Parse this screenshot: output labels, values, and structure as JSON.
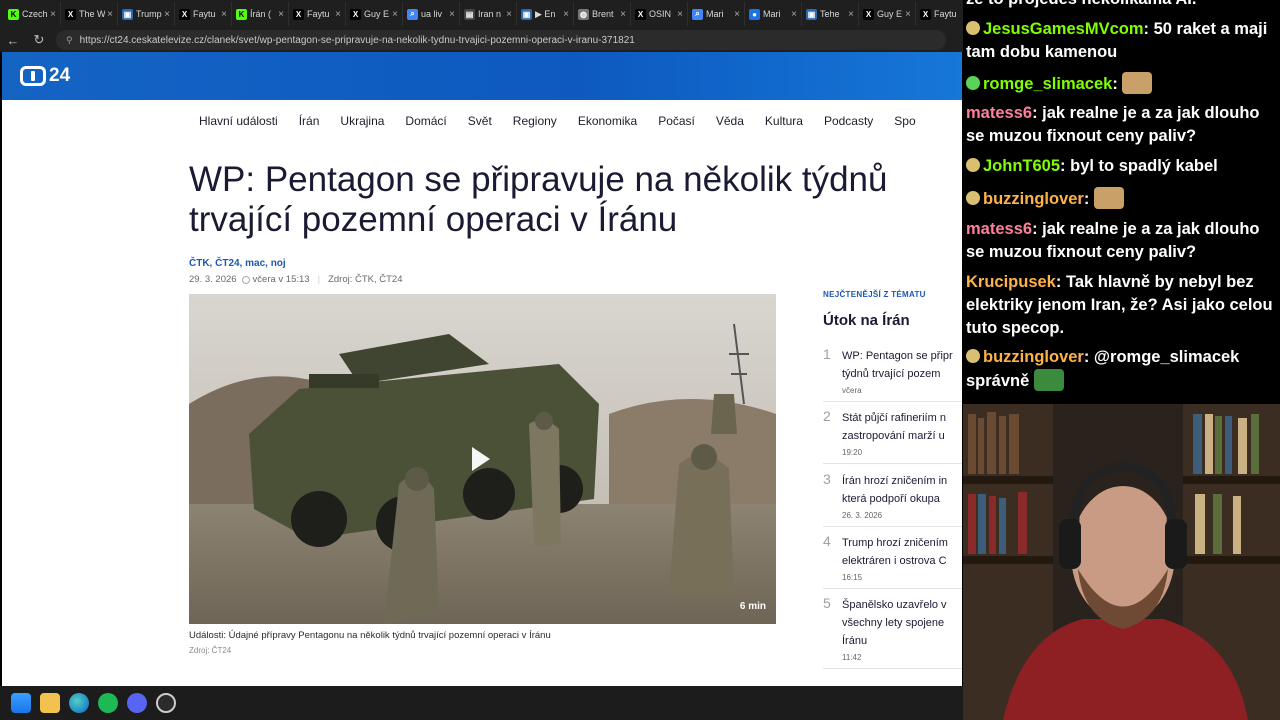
{
  "browser": {
    "tabs": [
      {
        "label": "Czech",
        "icon": "k-logo-icon",
        "color": "#53fc18"
      },
      {
        "label": "The W",
        "icon": "x-logo-icon",
        "color": "#000000"
      },
      {
        "label": "Trump",
        "icon": "tv-icon",
        "color": "#2b6cb0"
      },
      {
        "label": "Faytu",
        "icon": "x-logo-icon",
        "color": "#000000"
      },
      {
        "label": "Írán (",
        "icon": "k-logo-icon",
        "color": "#53fc18"
      },
      {
        "label": "Faytu",
        "icon": "x-logo-icon",
        "color": "#000000"
      },
      {
        "label": "Guy E",
        "icon": "x-logo-icon",
        "color": "#000000"
      },
      {
        "label": "ua liv",
        "icon": "search-icon",
        "color": "#4285f4"
      },
      {
        "label": "Iran n",
        "icon": "news-icon",
        "color": "#ffffff"
      },
      {
        "label": "▶ En",
        "icon": "tv-icon",
        "color": "#2b6cb0"
      },
      {
        "label": "Brent",
        "icon": "globe-icon",
        "color": "#777777"
      },
      {
        "label": "OSIN",
        "icon": "x-logo-icon",
        "color": "#000000"
      },
      {
        "label": "Mari",
        "icon": "search-icon",
        "color": "#4285f4"
      },
      {
        "label": "Mari",
        "icon": "circle-icon",
        "color": "#1a73e8"
      },
      {
        "label": "Tehe",
        "icon": "tv-icon",
        "color": "#2b6cb0"
      },
      {
        "label": "Guy E",
        "icon": "x-logo-icon",
        "color": "#000000"
      },
      {
        "label": "Faytu",
        "icon": "x-logo-icon",
        "color": "#000000"
      }
    ],
    "url": "https://ct24.ceskatelevize.cz/clanek/svet/wp-pentagon-se-pripravuje-na-nekolik-tydnu-trvajici-pozemni-operaci-v-iranu-371821"
  },
  "site": {
    "logo_text": "24",
    "nav": [
      "Hlavní události",
      "Írán",
      "Ukrajina",
      "Domácí",
      "Svět",
      "Regiony",
      "Ekonomika",
      "Počasí",
      "Věda",
      "Kultura",
      "Podcasty",
      "Spo"
    ]
  },
  "article": {
    "headline": "WP: Pentagon se připravuje na několik týdnů trvající pozemní operaci v Íránu",
    "authors": "ČTK, ČT24, mac, noj",
    "date": "29. 3. 2026",
    "updated": "včera v 15:13",
    "source": "Zdroj: ČTK, ČT24",
    "video_duration": "6 min",
    "caption": "Události: Údajné přípravy Pentagonu na několik týdnů trvající pozemní operaci v Íránu",
    "caption_source": "Zdroj: ČT24"
  },
  "sidebar": {
    "kicker": "NEJČTENĚJŠÍ Z TÉMATU",
    "title": "Útok na Írán",
    "items": [
      {
        "num": "1",
        "text": "WP: Pentagon se připr\ntýdnů trvající pozem",
        "time": "včera"
      },
      {
        "num": "2",
        "text": "Stát půjčí rafineriím n\nzastropování marží u",
        "time": "19:20"
      },
      {
        "num": "3",
        "text": "Írán hrozí zničením in\nkterá podpoří okupa",
        "time": "26. 3. 2026"
      },
      {
        "num": "4",
        "text": "Trump hrozí zničením\nelektráren i ostrova C",
        "time": "16:15"
      },
      {
        "num": "5",
        "text": "Španělsko uzavřelo v\nvšechny lety spojene\nÍránu",
        "time": "11:42"
      }
    ]
  },
  "chat": {
    "top_partial": "že to projedes několikama AI.",
    "messages": [
      {
        "user": "JesusGamesMVcom",
        "user_color": "#7fff00",
        "badge_color": "#d8c070",
        "text": " 50 raket a maji tam dobu kamenou",
        "emote": ""
      },
      {
        "user": "romge_slimacek",
        "user_color": "#7fff00",
        "badge_color": "#5ad35a",
        "text": " ",
        "emote": "cat-emote"
      },
      {
        "user": "matess6",
        "user_color": "#ff7f9f",
        "badge_color": "",
        "text": " jak realne je a za jak dlouho se muzou fixnout ceny paliv?",
        "emote": ""
      },
      {
        "user": "JohnT605",
        "user_color": "#7fff00",
        "badge_color": "#d8c070",
        "text": " byl to spadlý kabel",
        "emote": ""
      },
      {
        "user": "buzzinglover",
        "user_color": "#ffb347",
        "badge_color": "#d8c070",
        "text": " ",
        "emote": "cat-emote"
      },
      {
        "user": "matess6",
        "user_color": "#ff7f9f",
        "badge_color": "",
        "text": " jak realne je a za jak dlouho se muzou fixnout ceny paliv?",
        "emote": ""
      },
      {
        "user": "Krucipusek",
        "user_color": "#ffb347",
        "badge_color": "",
        "text": " Tak hlavně by nebyl bez elektriky jenom Iran, že? Asi jako celou tuto specop.",
        "emote": ""
      },
      {
        "user": "buzzinglover",
        "user_color": "#ffb347",
        "badge_color": "#d8c070",
        "text": " @romge_slimacek správně",
        "emote": "frog-emote"
      }
    ]
  }
}
